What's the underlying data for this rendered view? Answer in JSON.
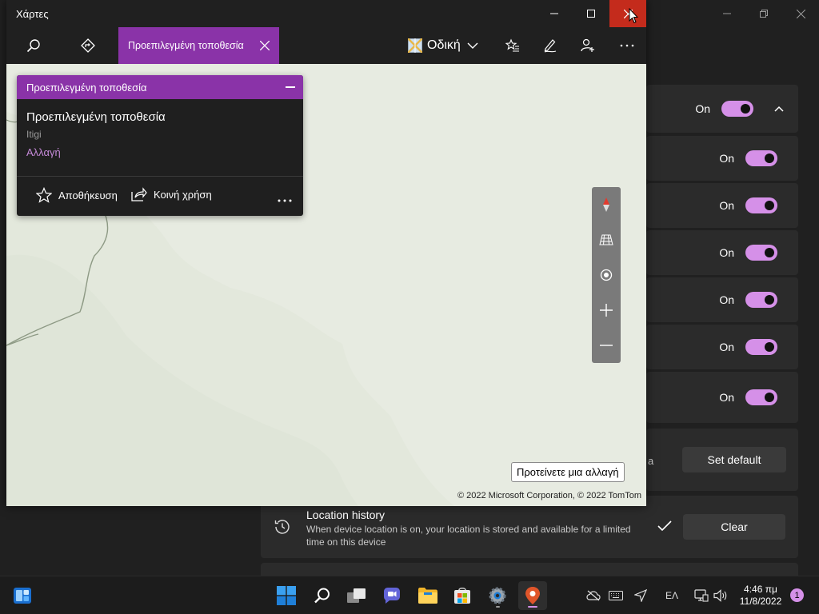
{
  "settings": {
    "toggles": [
      {
        "label": "On"
      },
      {
        "label": "On"
      },
      {
        "label": "On"
      },
      {
        "label": "On"
      },
      {
        "label": "On"
      },
      {
        "label": "On"
      },
      {
        "label": "On"
      }
    ],
    "default_row": {
      "fragment": "a",
      "button": "Set default"
    },
    "location_history": {
      "title": "Location history",
      "description": "When device location is on, your location is stored and available for a limited time on this device",
      "button": "Clear"
    }
  },
  "maps": {
    "title": "Χάρτες",
    "active_tab": "Προεπιλεγμένη τοποθεσία",
    "map_style": "Οδική",
    "info_card": {
      "header": "Προεπιλεγμένη τοποθεσία",
      "name": "Προεπιλεγμένη τοποθεσία",
      "subtitle": "Itigi",
      "change_link": "Αλλαγή",
      "save_label": "Αποθήκευση",
      "share_label": "Κοινή χρήση"
    },
    "suggest_change": "Προτείνετε μια αλλαγή",
    "copyright": "© 2022 Microsoft Corporation, © 2022 TomTom"
  },
  "taskbar": {
    "language": "ΕΛ",
    "time": "4:46 πμ",
    "date": "11/8/2022",
    "notification_count": "1"
  }
}
